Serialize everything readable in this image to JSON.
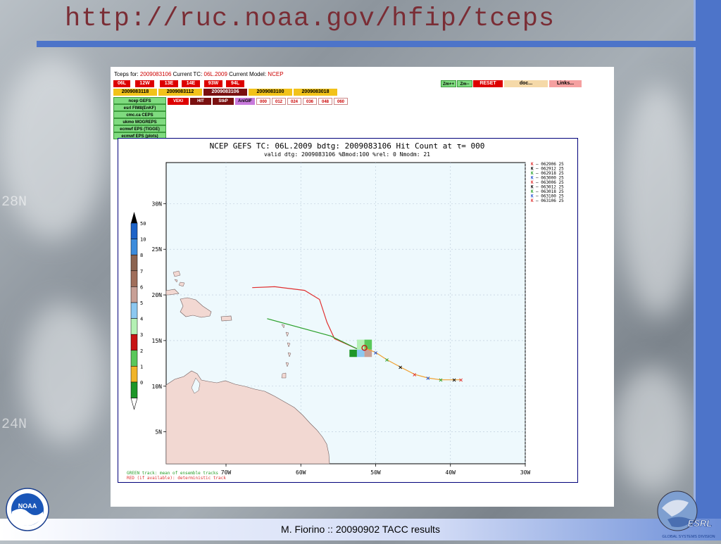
{
  "slide": {
    "title": "http://ruc.noaa.gov/hfip/tceps",
    "footer": "M. Fiorino :: 20090902 TACC results",
    "bg_labels": [
      "28N",
      "24N"
    ],
    "logo_left": "NOAA",
    "logo_right": "ESRL",
    "logo_right_sub": "GLOBAL SYSTEMS DIVISION"
  },
  "tceps": {
    "header": {
      "prefix": "Tceps for:",
      "dtg": "2009083106",
      "current_tc_label": "Current TC:",
      "current_tc": "06L.2009",
      "current_model_label": "Current Model:",
      "current_model": "NCEP"
    },
    "storm_buttons": [
      "06L",
      "12W",
      "13E",
      "14E",
      "93W",
      "94L"
    ],
    "dtg_buttons": [
      "2009083118",
      "2009083112",
      "2009083106",
      "2009083100",
      "2009083018"
    ],
    "model_buttons": [
      "ncep GEFS",
      "esrl FIM8(EnKF)",
      "cmc.ca CEPS",
      "ukmo MOGREPS",
      "ecmwf EPS (TIGGE)",
      "ecmwf EPS (plots)"
    ],
    "product_buttons": [
      "VEKI",
      "HIT",
      "StkP",
      "AniGIF"
    ],
    "tau_buttons": [
      "000",
      "012",
      "024",
      "036",
      "048",
      "060"
    ],
    "control_buttons": [
      "Zm++",
      "Zm--",
      "RESET",
      "doc...",
      "Links..."
    ]
  },
  "chart_data": {
    "type": "map",
    "title": "NCEP GEFS TC: 06L.2009 bdtg: 2009083106 Hit Count at τ= 000",
    "subtitle": "valid dtg: 2009083106  %Bmod:100 %rel: 0  Nmodm: 21",
    "x_ticks": [
      "70W",
      "60W",
      "50W",
      "40W",
      "30W"
    ],
    "y_ticks": [
      "30N",
      "25N",
      "20N",
      "15N",
      "10N",
      "5N"
    ],
    "xlim": [
      -78,
      -30
    ],
    "ylim": [
      1.5,
      34.5
    ],
    "colorbar_labels": [
      "50",
      "10",
      "8",
      "7",
      "6",
      "5",
      "4",
      "3",
      "2",
      "1",
      "0"
    ],
    "colorbar_colors": [
      "#1e64c8",
      "#3c8cdc",
      "#8c6450",
      "#a06e5a",
      "#c8a096",
      "#8cc8f0",
      "#b4f0b4",
      "#c81414",
      "#5ac85a",
      "#f0b428",
      "#1e9628"
    ],
    "legend": [
      {
        "label": "062906  25",
        "color": "#e03030"
      },
      {
        "label": "062912  25",
        "color": "#000000"
      },
      {
        "label": "062918  25",
        "color": "#2aa02a"
      },
      {
        "label": "063000  25",
        "color": "#2050d0"
      },
      {
        "label": "063006  25",
        "color": "#e03030"
      },
      {
        "label": "063012  25",
        "color": "#000000"
      },
      {
        "label": "063018  25",
        "color": "#2aa02a"
      },
      {
        "label": "063100  25",
        "color": "#2050d0"
      },
      {
        "label": "063106  25",
        "color": "#e03030"
      }
    ],
    "notes": [
      {
        "text": "GREEN track: mean of ensemble tracks",
        "color": "#2aa02a"
      },
      {
        "text": "RED (if available): deterministic track",
        "color": "#e03030"
      }
    ],
    "green_track": [
      [
        -64.5,
        17.4
      ],
      [
        -56,
        15.5
      ],
      [
        -52.5,
        14.1
      ]
    ],
    "red_track": [
      [
        -66.5,
        20.8
      ],
      [
        -63.5,
        20.9
      ],
      [
        -59.5,
        20.5
      ],
      [
        -57.5,
        19.5
      ],
      [
        -56.5,
        17
      ],
      [
        -55.5,
        15.2
      ],
      [
        -52.5,
        14.1
      ]
    ],
    "orange_track": [
      [
        -51.5,
        14.2
      ],
      [
        -50,
        13.7
      ],
      [
        -48.5,
        12.9
      ],
      [
        -46.7,
        12.1
      ],
      [
        -44.8,
        11.3
      ],
      [
        -43,
        10.9
      ],
      [
        -41.3,
        10.7
      ],
      [
        -39.5,
        10.7
      ],
      [
        -38.6,
        10.7
      ]
    ],
    "track_marks": [
      {
        "x": -50,
        "y": 13.7,
        "color": "#2050d0"
      },
      {
        "x": -48.5,
        "y": 12.9,
        "color": "#2aa02a"
      },
      {
        "x": -46.7,
        "y": 12.1,
        "color": "#000000"
      },
      {
        "x": -44.8,
        "y": 11.3,
        "color": "#e03030"
      },
      {
        "x": -43,
        "y": 10.9,
        "color": "#2050d0"
      },
      {
        "x": -41.3,
        "y": 10.7,
        "color": "#2aa02a"
      },
      {
        "x": -39.5,
        "y": 10.7,
        "color": "#000000"
      },
      {
        "x": -38.6,
        "y": 10.7,
        "color": "#e03030"
      }
    ],
    "hit_cells": [
      {
        "x0": -53.5,
        "x1": -52.5,
        "y0": 14.0,
        "y1": 13.2,
        "color": "#1e9628"
      },
      {
        "x0": -52.5,
        "x1": -51.5,
        "y0": 15.1,
        "y1": 14.0,
        "color": "#b4f0b4"
      },
      {
        "x0": -51.5,
        "x1": -50.5,
        "y0": 15.1,
        "y1": 14.0,
        "color": "#5ac85a"
      },
      {
        "x0": -52.5,
        "x1": -51.5,
        "y0": 14.0,
        "y1": 13.2,
        "color": "#8cc8f0"
      },
      {
        "x0": -51.5,
        "x1": -50.5,
        "y0": 14.0,
        "y1": 13.2,
        "color": "#c8a096"
      }
    ]
  }
}
